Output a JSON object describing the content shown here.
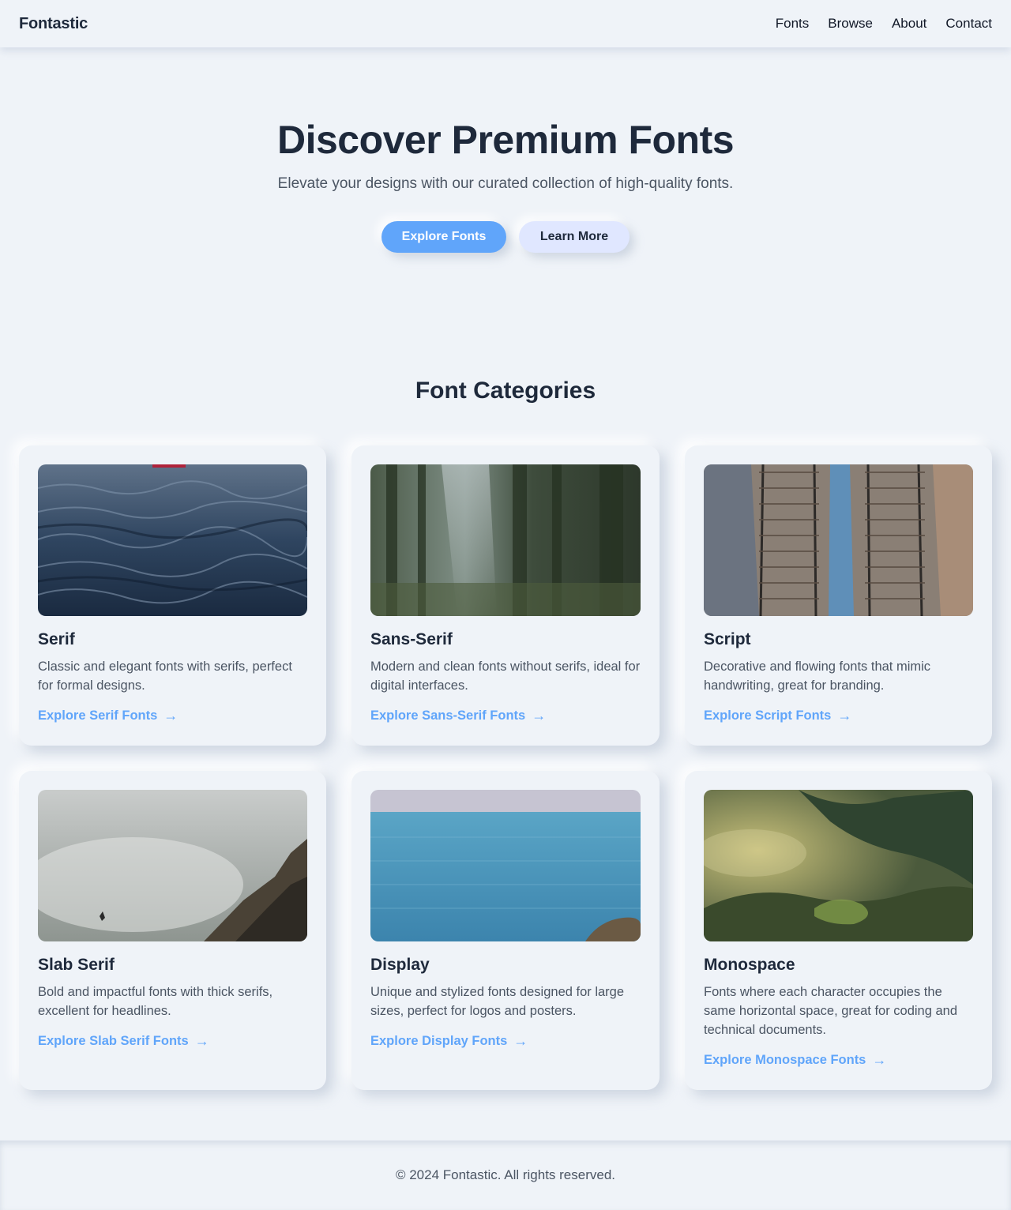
{
  "header": {
    "brand": "Fontastic",
    "nav": [
      "Fonts",
      "Browse",
      "About",
      "Contact"
    ]
  },
  "hero": {
    "title": "Discover Premium Fonts",
    "subtitle": "Elevate your designs with our curated collection of high-quality fonts.",
    "primary_button": "Explore Fonts",
    "secondary_button": "Learn More"
  },
  "categories": {
    "title": "Font Categories",
    "items": [
      {
        "title": "Serif",
        "description": "Classic and elegant fonts with serifs, perfect for formal designs.",
        "link": "Explore Serif Fonts",
        "image_icon": "ocean-waves-image"
      },
      {
        "title": "Sans-Serif",
        "description": "Modern and clean fonts without serifs, ideal for digital interfaces.",
        "link": "Explore Sans-Serif Fonts",
        "image_icon": "forest-light-image"
      },
      {
        "title": "Script",
        "description": "Decorative and flowing fonts that mimic handwriting, great for branding.",
        "link": "Explore Script Fonts",
        "image_icon": "railway-tracks-image"
      },
      {
        "title": "Slab Serif",
        "description": "Bold and impactful fonts with thick serifs, excellent for headlines.",
        "link": "Explore Slab Serif Fonts",
        "image_icon": "misty-cliff-image"
      },
      {
        "title": "Display",
        "description": "Unique and stylized fonts designed for large sizes, perfect for logos and posters.",
        "link": "Explore Display Fonts",
        "image_icon": "sea-horizon-image"
      },
      {
        "title": "Monospace",
        "description": "Fonts where each character occupies the same horizontal space, great for coding and technical documents.",
        "link": "Explore Monospace Fonts",
        "image_icon": "foggy-forest-image"
      }
    ]
  },
  "footer": {
    "text": "© 2024 Fontastic. All rights reserved."
  },
  "colors": {
    "background": "#eff3f8",
    "accent": "#60a5fa",
    "secondary_button": "#e0e7ff",
    "heading": "#1e293b",
    "body_text": "#4b5563"
  }
}
